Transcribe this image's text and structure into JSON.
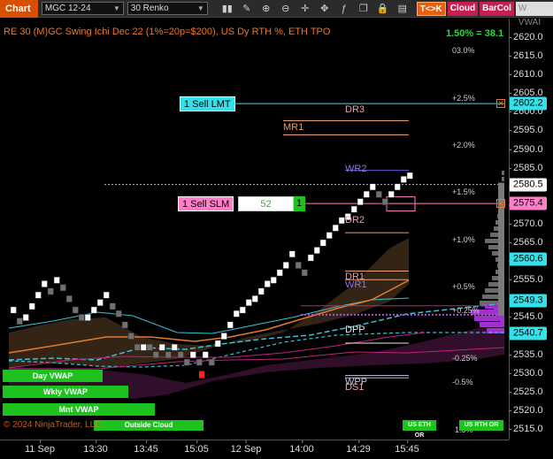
{
  "toolbar": {
    "chart_tab": "Chart",
    "symbol": "MGC 12-24",
    "interval": "30 Renko",
    "icons": [
      "bar-style-icon",
      "draw-icon",
      "zoom-in-icon",
      "zoom-out-icon",
      "crosshair-icon",
      "pan-icon",
      "indicator-icon",
      "clone-icon",
      "lock-icon",
      "data-box-icon",
      "toggle-icon"
    ],
    "btn_tk": "T<>K",
    "btn_cloud": "Cloud",
    "btn_barcol": "BarCol",
    "btn_vwap": "W VWAI"
  },
  "chart": {
    "title": "RE 30 (M)GC Swing Ichi Dec 22 (1%=20p=$200), US Dy RTH %, ETH TPO",
    "pct_readout": "1.50% = 38.1",
    "copyright": "© 2024 NinjaTrader, LLC"
  },
  "orders": {
    "sell_lmt_label": "1 Sell LMT",
    "sell_slm_label": "1 Sell SLM",
    "sell_slm_qty": "52",
    "sell_slm_count": "1"
  },
  "levels": {
    "dr3": "DR3",
    "mr1": "MR1",
    "wr2": "WR2",
    "dr2": "DR2",
    "dr1": "DR1",
    "wr1": "WR1",
    "dpp": "DPP",
    "wpp": "WPP",
    "ds1": "DS1"
  },
  "pct_levels": [
    "03.0%",
    "+2.5%",
    "+2.0%",
    "+1.5%",
    "+1.0%",
    "+0.5%",
    "+0.25%",
    "-0.25%",
    "-0.5%",
    "1.5%"
  ],
  "vwap_labels": {
    "day": "Day VWAP",
    "wkly": "Wkly VWAP",
    "mnt": "Mnt VWAP",
    "outside_cloud": "Outside Cloud",
    "us_eth_or": "US ETH OR",
    "us_rth_or": "US RTH OR"
  },
  "price_axis": {
    "ticks": [
      "2620.0",
      "2615.0",
      "2610.0",
      "2605.0",
      "2600.0",
      "2595.0",
      "2590.0",
      "2585.0",
      "2580.0",
      "2575.0",
      "2570.0",
      "2565.0",
      "2560.0",
      "2555.0",
      "2550.0",
      "2545.0",
      "2540.0",
      "2535.0",
      "2530.0",
      "2525.0",
      "2520.0",
      "2515.0"
    ],
    "flags": {
      "lmt": "2602.2",
      "last": "2580.5",
      "slm": "2575.4",
      "f1": "2560.6",
      "f2": "2549.3",
      "f3": "2540.7"
    }
  },
  "time_axis": [
    "11 Sep",
    "13:30",
    "13:45",
    "15:05",
    "12 Sep",
    "14:00",
    "14:29",
    "15:45"
  ],
  "colors": {
    "up_brick": "#ffffff",
    "down_brick": "#6e6e6e",
    "accent_orange": "#e8792a",
    "cyan": "#35e0e8",
    "pink": "#ff7fc8",
    "green": "#1ec21e",
    "magenta": "#b04fd8"
  }
}
